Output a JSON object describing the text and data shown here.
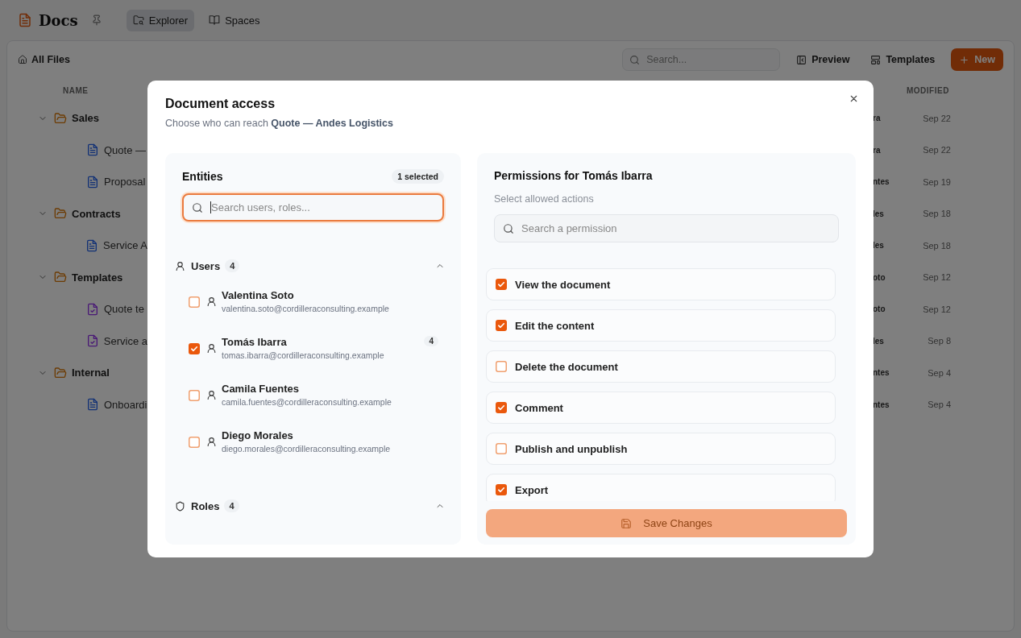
{
  "app": {
    "title": "Docs"
  },
  "nav_tabs": [
    {
      "label": "Explorer",
      "selected": true
    },
    {
      "label": "Spaces",
      "selected": false
    }
  ],
  "toolbar": {
    "breadcrumb": "All Files",
    "search": {
      "placeholder": "Search..."
    },
    "actions": [
      {
        "label": "Preview",
        "kind": "preview"
      },
      {
        "label": "Templates",
        "kind": "templates"
      },
      {
        "label": "New",
        "kind": "new"
      }
    ]
  },
  "table": {
    "columns": [
      "NAME",
      "MODIFIED"
    ],
    "rows": [
      {
        "name": "Sales",
        "kind": "folder",
        "expanded": true,
        "owner": "ra",
        "modified": "Sep 22",
        "children": [
          {
            "name": "Quote —",
            "kind": "document",
            "owner": "ra",
            "modified": "Sep 22"
          },
          {
            "name": "Proposal",
            "kind": "document",
            "owner": "ntes",
            "modified": "Sep 19"
          }
        ]
      },
      {
        "name": "Contracts",
        "kind": "folder",
        "expanded": true,
        "owner": "les",
        "modified": "Sep 18",
        "children": [
          {
            "name": "Service A",
            "kind": "document",
            "owner": "les",
            "modified": "Sep 18"
          }
        ]
      },
      {
        "name": "Templates",
        "kind": "folder",
        "expanded": true,
        "owner": "oto",
        "modified": "Sep 12",
        "children": [
          {
            "name": "Quote te",
            "kind": "template",
            "owner": "oto",
            "modified": "Sep 12"
          },
          {
            "name": "Service a",
            "kind": "template",
            "owner": "les",
            "modified": "Sep 8"
          }
        ]
      },
      {
        "name": "Internal",
        "kind": "folder",
        "expanded": true,
        "owner": "ntes",
        "modified": "Sep 4",
        "children": [
          {
            "name": "Onboardi",
            "kind": "document",
            "owner": "ntes",
            "modified": "Sep 4"
          }
        ]
      }
    ]
  },
  "dialog": {
    "title": "Document access",
    "subtitle": "Choose who can reach **Quote — Andes Logistics**",
    "entities": {
      "title": "Entities",
      "selection": "1 selected",
      "search": {
        "placeholder": "Search users, roles...",
        "focused": true
      },
      "sections": [
        {
          "label": "Users",
          "kind": "users",
          "count": "4",
          "expanded": true,
          "items": [
            {
              "name": "Valentina Soto",
              "email": "valentina.soto@cordilleraconsulting.example",
              "checked": false
            },
            {
              "name": "Tomás Ibarra",
              "email": "tomas.ibarra@cordilleraconsulting.example",
              "checked": true,
              "badge": "4"
            },
            {
              "name": "Camila Fuentes",
              "email": "camila.fuentes@cordilleraconsulting.example",
              "checked": false
            },
            {
              "name": "Diego Morales",
              "email": "diego.morales@cordilleraconsulting.example",
              "checked": false
            }
          ]
        },
        {
          "label": "Roles",
          "kind": "roles",
          "count": "4",
          "expanded": true
        }
      ]
    },
    "permissions": {
      "title": "Permissions for Tomás Ibarra",
      "subtitle": "Select allowed actions",
      "search": {
        "placeholder": "Search a permission"
      },
      "items": [
        {
          "label": "View the document",
          "checked": true
        },
        {
          "label": "Edit the content",
          "checked": true
        },
        {
          "label": "Delete the document",
          "checked": false
        },
        {
          "label": "Comment",
          "checked": true
        },
        {
          "label": "Publish and unpublish",
          "checked": false
        },
        {
          "label": "Export",
          "checked": true
        }
      ],
      "save": {
        "label": "Save Changes",
        "disabled": true
      }
    }
  }
}
